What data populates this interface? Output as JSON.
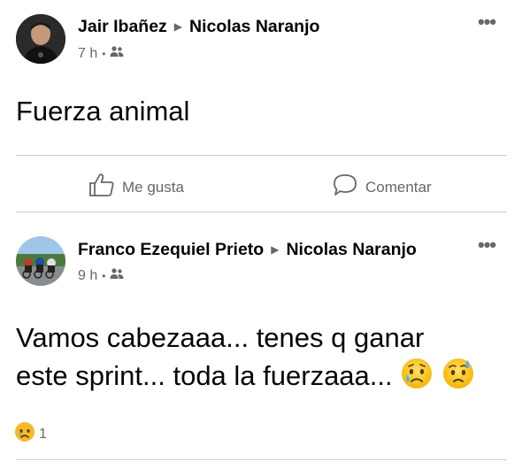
{
  "posts": [
    {
      "author": "Jair Ibañez",
      "recipient": "Nicolas Naranjo",
      "time": "7 h",
      "privacy_icon": "group-icon",
      "text": "Fuerza animal",
      "actions": {
        "like": "Me gusta",
        "comment": "Comentar"
      }
    },
    {
      "author": "Franco Ezequiel Prieto",
      "recipient": "Nicolas Naranjo",
      "time": "9 h",
      "privacy_icon": "group-icon",
      "text_line1": "Vamos cabezaaa... tenes q ganar",
      "text_line2": "este sprint... toda la fuerzaaa...",
      "reaction_count": "1",
      "reaction_icon": "sad-reaction-icon"
    }
  ],
  "separator": "•",
  "arrow": "▶",
  "colors": {
    "text": "#050505",
    "secondary": "#65676b",
    "divider": "#ced0d4"
  }
}
